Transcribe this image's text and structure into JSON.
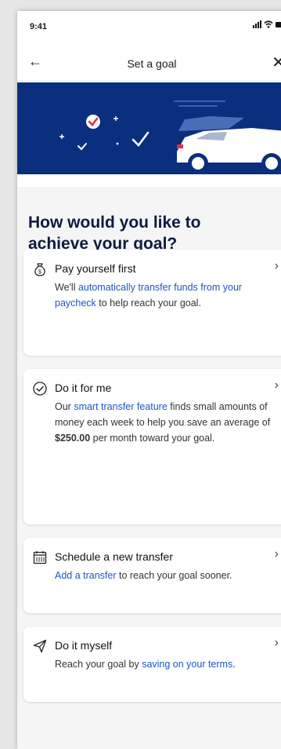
{
  "status": {
    "time": "9:41"
  },
  "nav": {
    "title": "Set a goal",
    "back_glyph": "←",
    "close_glyph": "✕"
  },
  "heading": "How would you like to achieve your goal?",
  "cards": [
    {
      "icon": "money-bag-icon",
      "title": "Pay yourself first",
      "desc_1": "We'll ",
      "desc_link": "automatically transfer funds from your paycheck",
      "desc_2": " to help reach your goal."
    },
    {
      "icon": "check-circle-icon",
      "title": "Do it for me",
      "desc_1": "Our ",
      "desc_link": "smart transfer feature",
      "desc_2": " finds small amounts of money each week to help you save an average of ",
      "desc_bold": "$250.00",
      "desc_3": " per month toward your goal."
    },
    {
      "icon": "calendar-icon",
      "title": "Schedule a new transfer",
      "desc_1": "",
      "desc_link": "Add a transfer",
      "desc_2": " to reach your goal sooner."
    },
    {
      "icon": "paper-plane-icon",
      "title": "Do it myself",
      "desc_1": "Reach your goal by ",
      "desc_link": "saving on your terms",
      "desc_2": "."
    }
  ],
  "chevron": "›",
  "colors": {
    "hero": "#0b2f7f",
    "link": "#1a56c4",
    "check": "#e0323c"
  }
}
